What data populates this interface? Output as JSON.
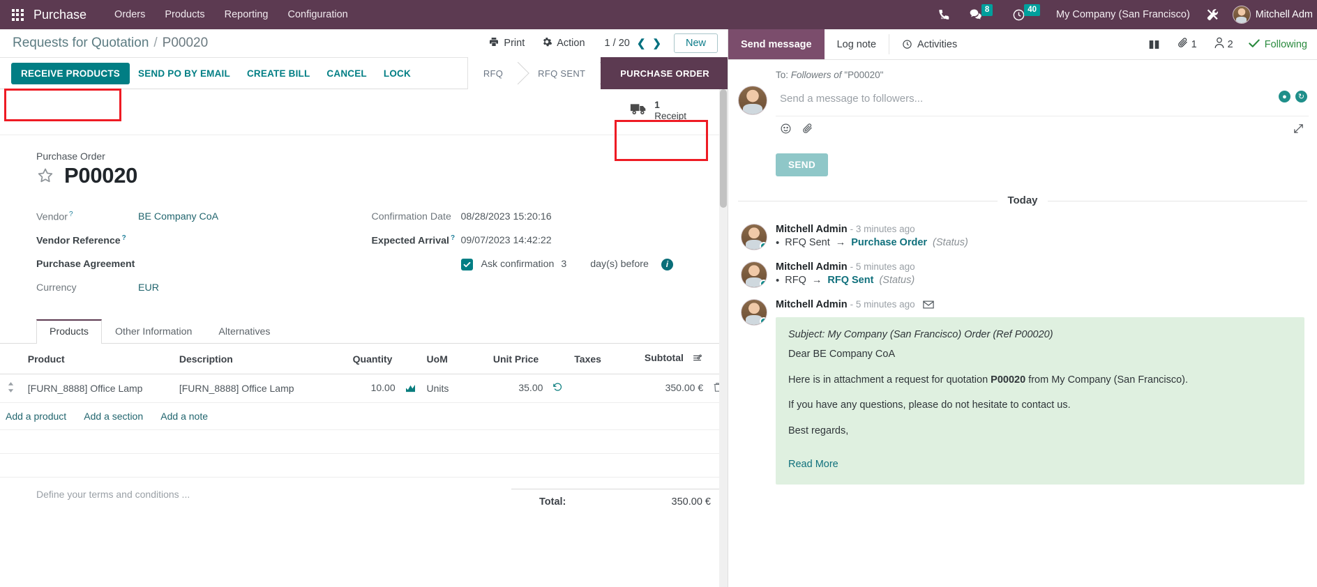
{
  "navbar": {
    "apps_icon": "apps-grid-icon",
    "brand": "Purchase",
    "menu": [
      "Orders",
      "Products",
      "Reporting",
      "Configuration"
    ],
    "phone_icon": "phone-icon",
    "messages_icon": "messages-icon",
    "messages_count": "8",
    "activities_icon": "clock-icon",
    "activities_count": "40",
    "company": "My Company (San Francisco)",
    "tools_icon": "tools-icon",
    "user": "Mitchell Adm",
    "bg_color": "#5c3a51",
    "badge_color": "#00a09d"
  },
  "control_panel": {
    "breadcrumb_root": "Requests for Quotation",
    "breadcrumb_sep": "/",
    "breadcrumb_current": "P00020",
    "print_label": "Print",
    "print_icon": "printer-icon",
    "action_label": "Action",
    "action_icon": "gear-icon",
    "pager": "1 / 20",
    "prev_icon": "chevron-left-icon",
    "next_icon": "chevron-right-icon",
    "new_label": "New"
  },
  "action_bar": {
    "primary": "RECEIVE PRODUCTS",
    "buttons": [
      "SEND PO BY EMAIL",
      "CREATE BILL",
      "CANCEL",
      "LOCK"
    ],
    "statuses": [
      {
        "label": "RFQ",
        "active": false
      },
      {
        "label": "RFQ SENT",
        "active": false
      },
      {
        "label": "PURCHASE ORDER",
        "active": true
      }
    ],
    "primary_color": "#017e84",
    "active_status_color": "#5c3a51"
  },
  "smart_button": {
    "icon": "truck-icon",
    "count": "1",
    "label": "Receipt"
  },
  "form": {
    "sheet_label": "Purchase Order",
    "star_icon": "star-icon",
    "title": "P00020",
    "left_fields": [
      {
        "label": "Vendor",
        "help": "?",
        "value": "BE Company CoA",
        "link": true,
        "bold": false
      },
      {
        "label": "Vendor Reference",
        "help": "?",
        "value": "",
        "link": false,
        "bold": true
      },
      {
        "label": "Purchase Agreement",
        "help": "",
        "value": "",
        "link": false,
        "bold": true
      },
      {
        "label": "Currency",
        "help": "",
        "value": "EUR",
        "link": true,
        "bold": false
      }
    ],
    "right_fields": [
      {
        "label": "Confirmation Date",
        "help": "",
        "value": "08/28/2023 15:20:16",
        "bold": false
      },
      {
        "label": "Expected Arrival",
        "help": "?",
        "value": "09/07/2023 14:42:22",
        "bold": true
      }
    ],
    "ask_confirmation": {
      "checked": true,
      "check_icon": "check-icon",
      "label": "Ask confirmation",
      "days": "3",
      "suffix": "day(s) before",
      "info_icon": "info-icon"
    }
  },
  "notebook": {
    "tabs": [
      {
        "label": "Products",
        "active": true
      },
      {
        "label": "Other Information",
        "active": false
      },
      {
        "label": "Alternatives",
        "active": false
      }
    ],
    "columns": [
      "Product",
      "Description",
      "Quantity",
      "UoM",
      "Unit Price",
      "Taxes",
      "Subtotal"
    ],
    "settings_icon": "column-settings-icon",
    "rows": [
      {
        "handle_icon": "drag-handle-icon",
        "product": "[FURN_8888] Office Lamp",
        "description": "[FURN_8888] Office Lamp",
        "quantity": "10.00",
        "qty_icon": "forecast-icon",
        "uom": "Units",
        "unit_price": "35.00",
        "price_icon": "history-icon",
        "taxes": "",
        "subtotal": "350.00 €",
        "delete_icon": "trash-icon"
      }
    ],
    "add_links": [
      "Add a product",
      "Add a section",
      "Add a note"
    ]
  },
  "footer": {
    "terms_placeholder": "Define your terms and conditions ...",
    "total_label": "Total:",
    "total_value": "350.00 €"
  },
  "chatter": {
    "tabs": [
      {
        "label": "Send message",
        "active": true
      },
      {
        "label": "Log note",
        "active": false
      },
      {
        "label": "Activities",
        "active": false,
        "icon": "clock-icon"
      }
    ],
    "meta": [
      {
        "icon": "book-icon",
        "count": ""
      },
      {
        "icon": "paperclip-icon",
        "count": "1"
      },
      {
        "icon": "user-icon",
        "count": "2"
      }
    ],
    "following_icon": "check-icon",
    "following_label": "Following",
    "compose": {
      "to_prefix": "To:",
      "to_target": "Followers of",
      "to_record": "\"P00020\"",
      "placeholder": "Send a message to followers...",
      "emoji_icon": "emoji-icon",
      "attach_icon": "paperclip-icon",
      "expand_icon": "expand-icon",
      "lang_icon": "language-icon",
      "refresh_icon": "refresh-icon",
      "send_label": "SEND"
    },
    "date_separator": "Today",
    "messages": [
      {
        "author": "Mitchell Admin",
        "time": "- 3 minutes ago",
        "type": "tracking",
        "from": "RFQ Sent",
        "arrow": "→",
        "to": "Purchase Order",
        "field": "(Status)"
      },
      {
        "author": "Mitchell Admin",
        "time": "- 5 minutes ago",
        "type": "tracking",
        "from": "RFQ",
        "arrow": "→",
        "to": "RFQ Sent",
        "field": "(Status)"
      },
      {
        "author": "Mitchell Admin",
        "time": "- 5 minutes ago",
        "type": "email",
        "mail_icon": "envelope-icon",
        "subject": "Subject: My Company (San Francisco) Order (Ref P00020)",
        "greeting": "Dear BE Company CoA",
        "para1_pre": "Here is in attachment a request for quotation ",
        "para1_bold": "P00020",
        "para1_post": " from My Company (San Francisco).",
        "para2": "If you have any questions, please do not hesitate to contact us.",
        "para3": "Best regards,",
        "read_more": "Read More"
      }
    ]
  }
}
